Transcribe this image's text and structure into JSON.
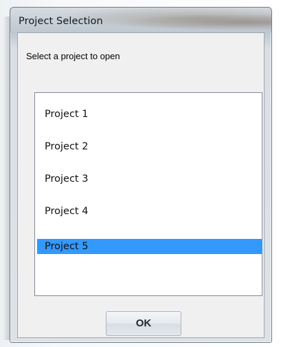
{
  "window": {
    "title": "Project Selection"
  },
  "dialog": {
    "prompt": "Select a project to open",
    "projects": [
      {
        "label": "Project 1",
        "selected": false
      },
      {
        "label": "Project 2",
        "selected": false
      },
      {
        "label": "Project 3",
        "selected": false
      },
      {
        "label": "Project 4",
        "selected": false
      },
      {
        "label": "Project 5",
        "selected": true
      }
    ],
    "ok_label": "OK"
  },
  "colors": {
    "selection": "#3399ff",
    "title_text": "#101820"
  }
}
